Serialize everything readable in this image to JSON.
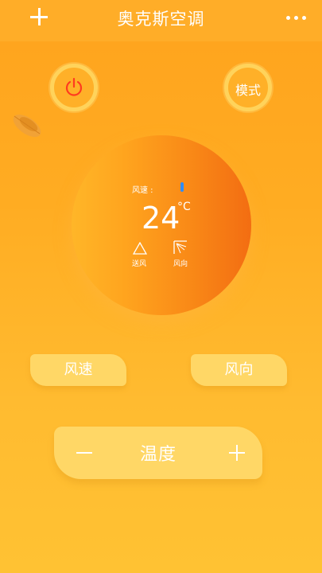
{
  "header": {
    "title": "奥克斯空调",
    "add_icon": "plus-icon",
    "more_icon": "more-dots-icon",
    "background": "#ffad28"
  },
  "controls": {
    "power_icon": "power-icon",
    "power_color": "#ff3b1f",
    "mode_label": "模式"
  },
  "dial": {
    "wind_label": "风速 :",
    "wind_level_color": "#2f8cff",
    "temperature": "24",
    "unit": "°C",
    "mode_icon": "triangle-icon",
    "mode_label": "送风",
    "direction_icon": "fan-direction-icon",
    "direction_label": "风向"
  },
  "buttons": {
    "wind_speed_label": "风速",
    "wind_direction_label": "风向"
  },
  "temperature_control": {
    "label": "温度",
    "minus_icon": "minus-icon",
    "plus_icon": "plus-icon"
  },
  "colors": {
    "background_top": "#ffa31d",
    "background_bottom": "#ffc233",
    "button_fill": "#ffd766",
    "dial_right": "#f36d12"
  }
}
